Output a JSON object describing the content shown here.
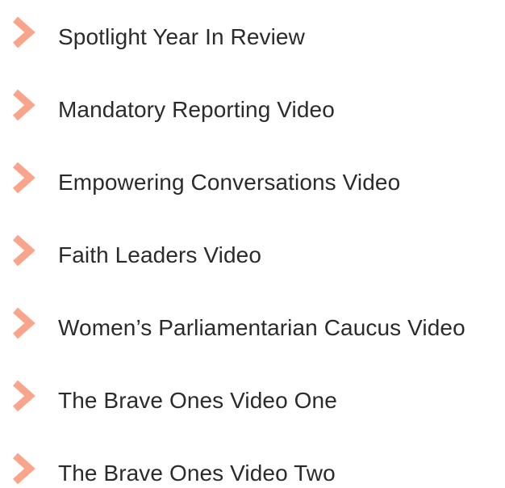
{
  "colors": {
    "chevron": "#f9a58c",
    "text": "#2b2b2b"
  },
  "icon": "chevron-right-icon",
  "links": [
    {
      "label": "Spotlight Year In Review"
    },
    {
      "label": "Mandatory Reporting Video"
    },
    {
      "label": "Empowering Conversations Video"
    },
    {
      "label": "Faith Leaders Video"
    },
    {
      "label": "Women’s Parliamentarian Caucus Video"
    },
    {
      "label": "The Brave Ones Video One"
    },
    {
      "label": "The Brave Ones Video Two"
    }
  ]
}
